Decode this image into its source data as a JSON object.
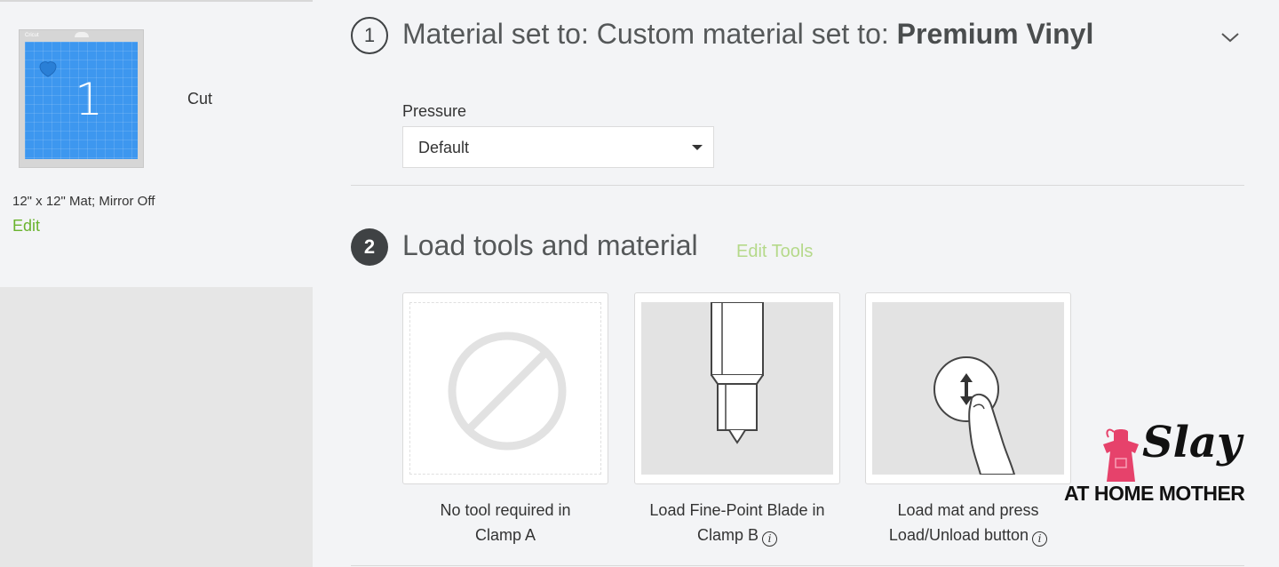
{
  "sidebar": {
    "mat_number": "1",
    "mat_brand": "Cricut",
    "operation": "Cut",
    "mat_info": "12\" x 12\" Mat; Mirror Off",
    "edit_label": "Edit"
  },
  "step1": {
    "number": "1",
    "title_prefix": "Material set to: Custom material set to: ",
    "title_bold": "Premium Vinyl",
    "pressure_label": "Pressure",
    "pressure_value": "Default"
  },
  "step2": {
    "number": "2",
    "title": "Load tools and material",
    "edit_tools_label": "Edit Tools",
    "tools": [
      {
        "line1": "No tool required in",
        "line2": "Clamp A",
        "has_info": false
      },
      {
        "line1": "Load Fine-Point Blade in",
        "line2": "Clamp B",
        "has_info": true
      },
      {
        "line1": "Load mat and press",
        "line2": "Load/Unload button",
        "has_info": true
      }
    ]
  },
  "watermark": {
    "script": "Slay",
    "text": "AT HOME MOTHER"
  },
  "colors": {
    "accent_green": "#6ab32e",
    "edit_tools_green": "#b5d98a",
    "mat_blue": "#3d97ef",
    "step_dark": "#3f4244",
    "apron_pink": "#e6426b"
  }
}
